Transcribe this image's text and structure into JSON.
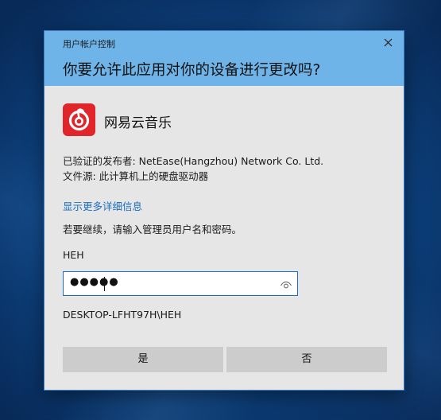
{
  "dialog": {
    "window_title": "用户帐户控制",
    "heading": "你要允许此应用对你的设备进行更改吗?",
    "close_icon": "close-icon",
    "app": {
      "name": "网易云音乐",
      "icon": "netease-cloud-music-icon",
      "icon_color": "#e0252b"
    },
    "publisher_line": "已验证的发布者: NetEase(Hangzhou) Network Co. Ltd.",
    "origin_line": "文件源: 此计算机上的硬盘驱动器",
    "details_link": "显示更多详细信息",
    "prompt": "若要继续，请输入管理员用户名和密码。",
    "username": "HEH",
    "password": {
      "masked_value": "●●●●●",
      "reveal_icon": "eye-icon"
    },
    "domain_user": "DESKTOP-LFHT97H\\HEH",
    "buttons": {
      "yes": "是",
      "no": "否"
    }
  },
  "colors": {
    "header_bg": "#6eb4e8",
    "body_bg": "#e6e6e6",
    "link": "#1a6fc2",
    "button_bg": "#cccccc"
  }
}
